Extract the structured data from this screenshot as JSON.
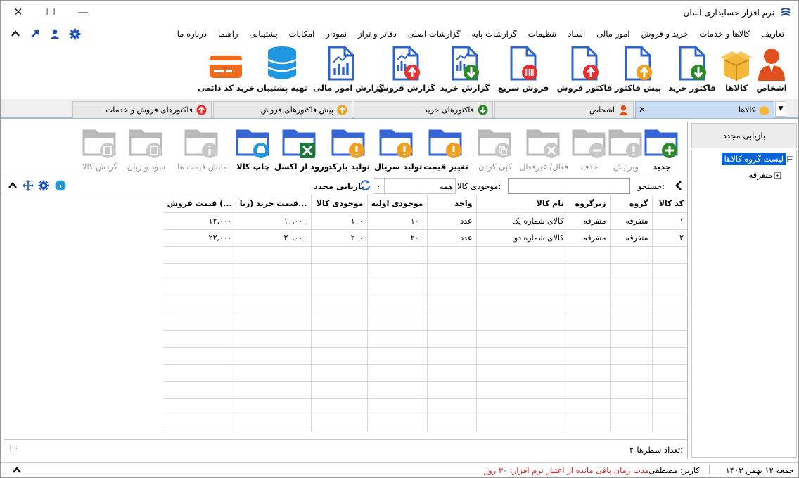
{
  "window": {
    "title": "نرم افزار حسابداری آسان"
  },
  "menu": [
    "تعاریف",
    "کالاها و خدمات",
    "خرید و فروش",
    "امور مالی",
    "اسناد",
    "تنظیمات",
    "گزارشات پایه",
    "گزارشات اصلی",
    "دفاتر و تراز",
    "نمودار",
    "امکانات",
    "پشتیبانی",
    "راهنما",
    "درباره ما"
  ],
  "ribbon": [
    "اشخاص",
    "کالاها",
    "فاکتور خرید",
    "پیش فاکتور",
    "فاکتور فروش",
    "فروش سریع",
    "گزارش خرید",
    "گزارش فروش",
    "گزارش امور مالی",
    "تهیه پشتیبان",
    "خرید کد دائمی"
  ],
  "tabs": [
    "کالاها",
    "اشخاص",
    "فاکتورهای خرید",
    "پیش فاکتورهای فروش",
    "فاکتورهای فروش و خدمات"
  ],
  "toolbar": [
    "جدید",
    "ویرایش",
    "حذف",
    "فعال/ غیرفعال",
    "کپی کردن",
    "تغییر قیمت",
    "تولید سریال",
    "تولید بارکد",
    "ورود از اکسل",
    "چاپ کالا",
    "نمایش قیمت ها",
    "سود و زیان",
    "گردش کالا"
  ],
  "filter": {
    "search_label": "جستجو:",
    "search_value": "",
    "stock_label": "موجودی کالا:",
    "stock_value": "همه",
    "refresh_label": "بازیابی مجدد"
  },
  "grid": {
    "columns": [
      "کد کالا",
      "گروه",
      "زیرگروه",
      "نام کالا",
      "واحد",
      "موجودی اولیه",
      "موجودی کالا",
      "قیمت خرید (ریا...",
      "قیمت فروش (..."
    ],
    "rows": [
      [
        "۱",
        "متفرقه",
        "متفرقه",
        "کالای شماره یک",
        "عدد",
        "۱۰۰",
        "۱۰۰",
        "۱۰,۰۰۰",
        "۱۲,۰۰۰"
      ],
      [
        "۲",
        "متفرقه",
        "متفرقه",
        "کالای شماره دو",
        "عدد",
        "۲۰۰",
        "۲۰۰",
        "۲۰,۰۰۰",
        "۲۲,۰۰۰"
      ]
    ],
    "row_count_label": "تعداد سطرها:",
    "row_count": "۲"
  },
  "side": {
    "refresh_label": "بازیابی مجدد",
    "tree_root": "لیست گروه کالاها",
    "tree_child": "متفرقه"
  },
  "status": {
    "date": "جمعه ۱۲ بهمن ۱۴۰۳",
    "user": "کاربر: مصطفی",
    "license": "مدت زمان باقی مانده از اعتبار نرم افزار: ۳۰ روز"
  },
  "colors": {
    "accent": "#2f64c8",
    "folder": "#3565d6",
    "warn": "#f0a020",
    "ok": "#2a8a2a",
    "danger": "#e53030",
    "disabled": "#b8b8b8"
  }
}
